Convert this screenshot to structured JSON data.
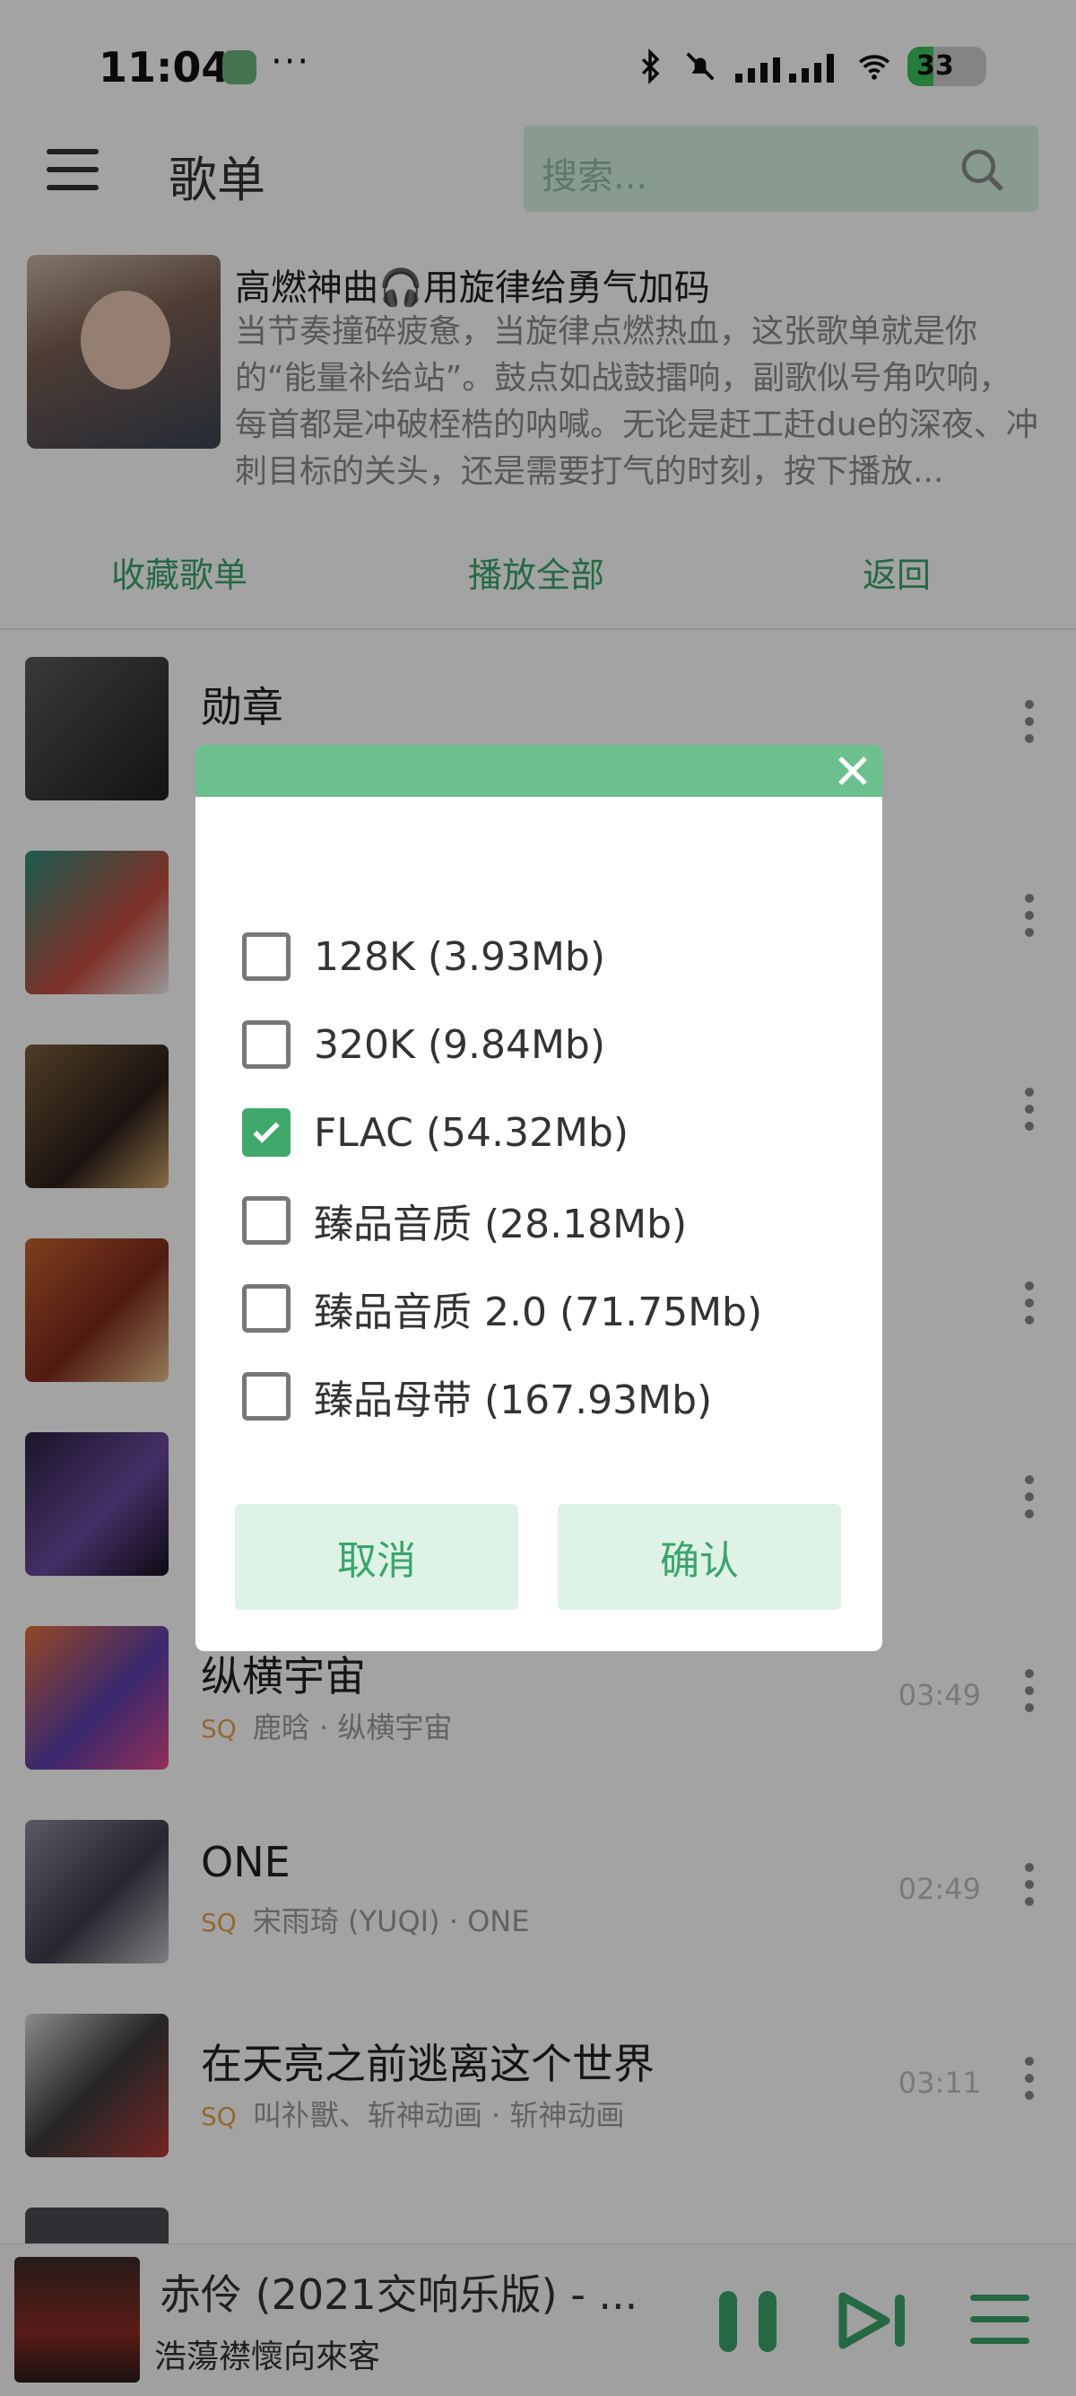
{
  "status_bar": {
    "time": "11:04",
    "dots": "···",
    "battery": "33"
  },
  "header": {
    "title": "歌单",
    "search_placeholder": "搜索..."
  },
  "playlist": {
    "title": "高燃神曲🎧用旋律给勇气加码",
    "description": "当节奏撞碎疲惫，当旋律点燃热血，这张歌单就是你的“能量补给站”。鼓点如战鼓擂响，副歌似号角吹响，每首都是冲破桎梏的呐喊。无论是赶工赶due的深夜、冲刺目标的关头，还是需要打气的时刻，按下播放...",
    "actions": {
      "collect": "收藏歌单",
      "play_all": "播放全部",
      "back": "返回"
    }
  },
  "songs": [
    {
      "title": "勋章",
      "quality": "",
      "artist": "",
      "duration": ""
    },
    {
      "title": "纵横宇宙",
      "quality": "SQ",
      "artist": "鹿晗 · 纵横宇宙",
      "duration": "03:49"
    },
    {
      "title": "ONE",
      "quality": "SQ",
      "artist": "宋雨琦 (YUQI) · ONE",
      "duration": "02:49"
    },
    {
      "title": "在天亮之前逃离这个世界",
      "quality": "SQ",
      "artist": "叫䃼獸、斩神动画 · 斩神动画",
      "duration": "03:11"
    }
  ],
  "dialog": {
    "options": [
      {
        "label": "128K (3.93Mb)",
        "checked": false
      },
      {
        "label": "320K (9.84Mb)",
        "checked": false
      },
      {
        "label": "FLAC (54.32Mb)",
        "checked": true
      },
      {
        "label": "臻品音质 (28.18Mb)",
        "checked": false
      },
      {
        "label": "臻品音质 2.0 (71.75Mb)",
        "checked": false
      },
      {
        "label": "臻品母带 (167.93Mb)",
        "checked": false
      }
    ],
    "cancel": "取消",
    "confirm": "确认"
  },
  "player": {
    "title": "赤伶 (2021交响乐版) - ...",
    "artist": "浩蕩襟懷向來客"
  },
  "colors": {
    "accent": "#3aa56b",
    "dialog_header": "#6cc08e",
    "search_bg": "#d6f2e1"
  }
}
